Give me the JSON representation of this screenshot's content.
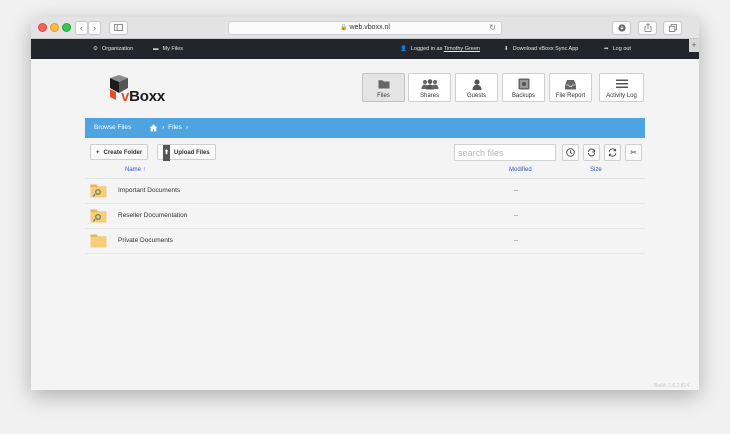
{
  "browser": {
    "url": "web.vboxx.nl"
  },
  "topnav": {
    "organization": "Organization",
    "my_files": "My Files",
    "logged_in_prefix": "Logged in as",
    "user_name": "Timothy Green",
    "download": "Download vBoxx Sync App",
    "logout": "Log out"
  },
  "logo": {
    "v": "v",
    "rest": "Boxx"
  },
  "nav_buttons": {
    "files": "Files",
    "shares": "Shares",
    "guests": "Guests",
    "backups": "Backups",
    "file_report": "File Report",
    "activity_log": "Activity Log"
  },
  "browse": {
    "title": "Browse Files",
    "crumb": "Files"
  },
  "actions": {
    "create_folder": "Create Folder",
    "upload_files": "Upload Files",
    "search_placeholder": "search files"
  },
  "table": {
    "headers": {
      "name": "Name ↑",
      "modified": "Modified",
      "size": "Size"
    },
    "rows": [
      {
        "name": "Important Documents",
        "modified": "--",
        "shared": true
      },
      {
        "name": "Reseller Documentation",
        "modified": "--",
        "shared": true
      },
      {
        "name": "Private Documents",
        "modified": "--",
        "shared": false
      }
    ]
  },
  "footer": {
    "version": "Build: 2.6.2.814"
  },
  "colors": {
    "accent": "#4ea4e0",
    "topnav": "#22252a",
    "logo_orange": "#e0502b",
    "folder": "#f1c56a"
  }
}
